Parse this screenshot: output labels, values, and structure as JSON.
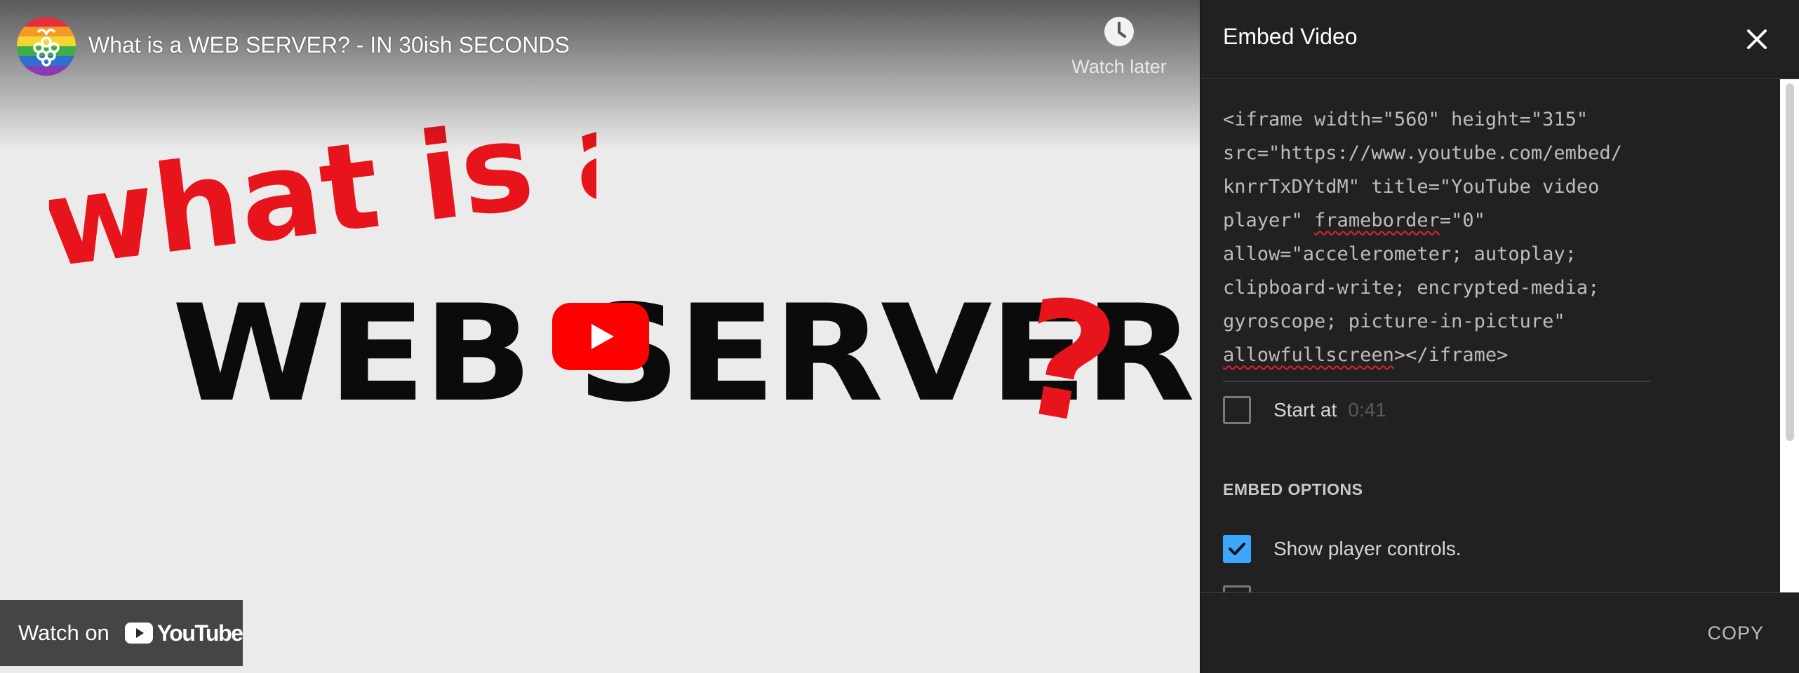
{
  "video": {
    "title": "What is a WEB SERVER? - IN 30ish SECONDS",
    "watch_later_label": "Watch later",
    "thumbnail_handwritten_text": "what is a",
    "thumbnail_headline": "WEB SERVER",
    "thumbnail_question_mark": "?",
    "watch_on_label": "Watch on",
    "youtube_wordmark": "YouTube",
    "play_icon": "play-icon",
    "colors": {
      "play_red": "#ff0000",
      "handwrite_red": "#e8141b",
      "background": "#ebebeb"
    }
  },
  "embed_panel": {
    "title": "Embed Video",
    "close_icon": "close-icon",
    "code_lines": [
      "<iframe width=\"560\" height=\"315\"",
      "src=\"https://www.youtube.com/embed/",
      "knrrTxDYtdM\" title=\"YouTube video",
      "player\" ",
      "frameborder",
      "=\"0\"",
      "allow=\"accelerometer; autoplay;",
      "clipboard-write; encrypted-media;",
      "gyroscope; picture-in-picture\"",
      "allowfullscreen",
      "></iframe>"
    ],
    "start_at_label": "Start at",
    "start_at_time": "0:41",
    "start_at_checked": false,
    "embed_options_heading": "EMBED OPTIONS",
    "show_controls_label": "Show player controls.",
    "show_controls_checked": true,
    "copy_label": "COPY",
    "colors": {
      "accent": "#3ea6ff",
      "panel_bg": "#212121"
    }
  }
}
